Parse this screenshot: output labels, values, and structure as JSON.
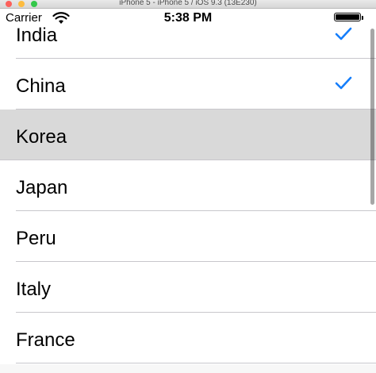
{
  "simulator": {
    "title": "iPhone 5 - iPhone 5 / iOS 9.3 (13E230)"
  },
  "status_bar": {
    "carrier": "Carrier",
    "time": "5:38 PM",
    "wifi_icon": "wifi-icon",
    "battery_icon": "battery-icon",
    "battery_level": 1.0
  },
  "table": {
    "rows": [
      {
        "label": "India",
        "checked": true,
        "selected": false
      },
      {
        "label": "China",
        "checked": true,
        "selected": false
      },
      {
        "label": "Korea",
        "checked": false,
        "selected": true
      },
      {
        "label": "Japan",
        "checked": false,
        "selected": false
      },
      {
        "label": "Peru",
        "checked": false,
        "selected": false
      },
      {
        "label": "Italy",
        "checked": false,
        "selected": false
      },
      {
        "label": "France",
        "checked": false,
        "selected": false
      }
    ]
  },
  "colors": {
    "tint": "#157efb",
    "selected_row": "#d9d9d9",
    "separator": "#c8c7cc"
  }
}
